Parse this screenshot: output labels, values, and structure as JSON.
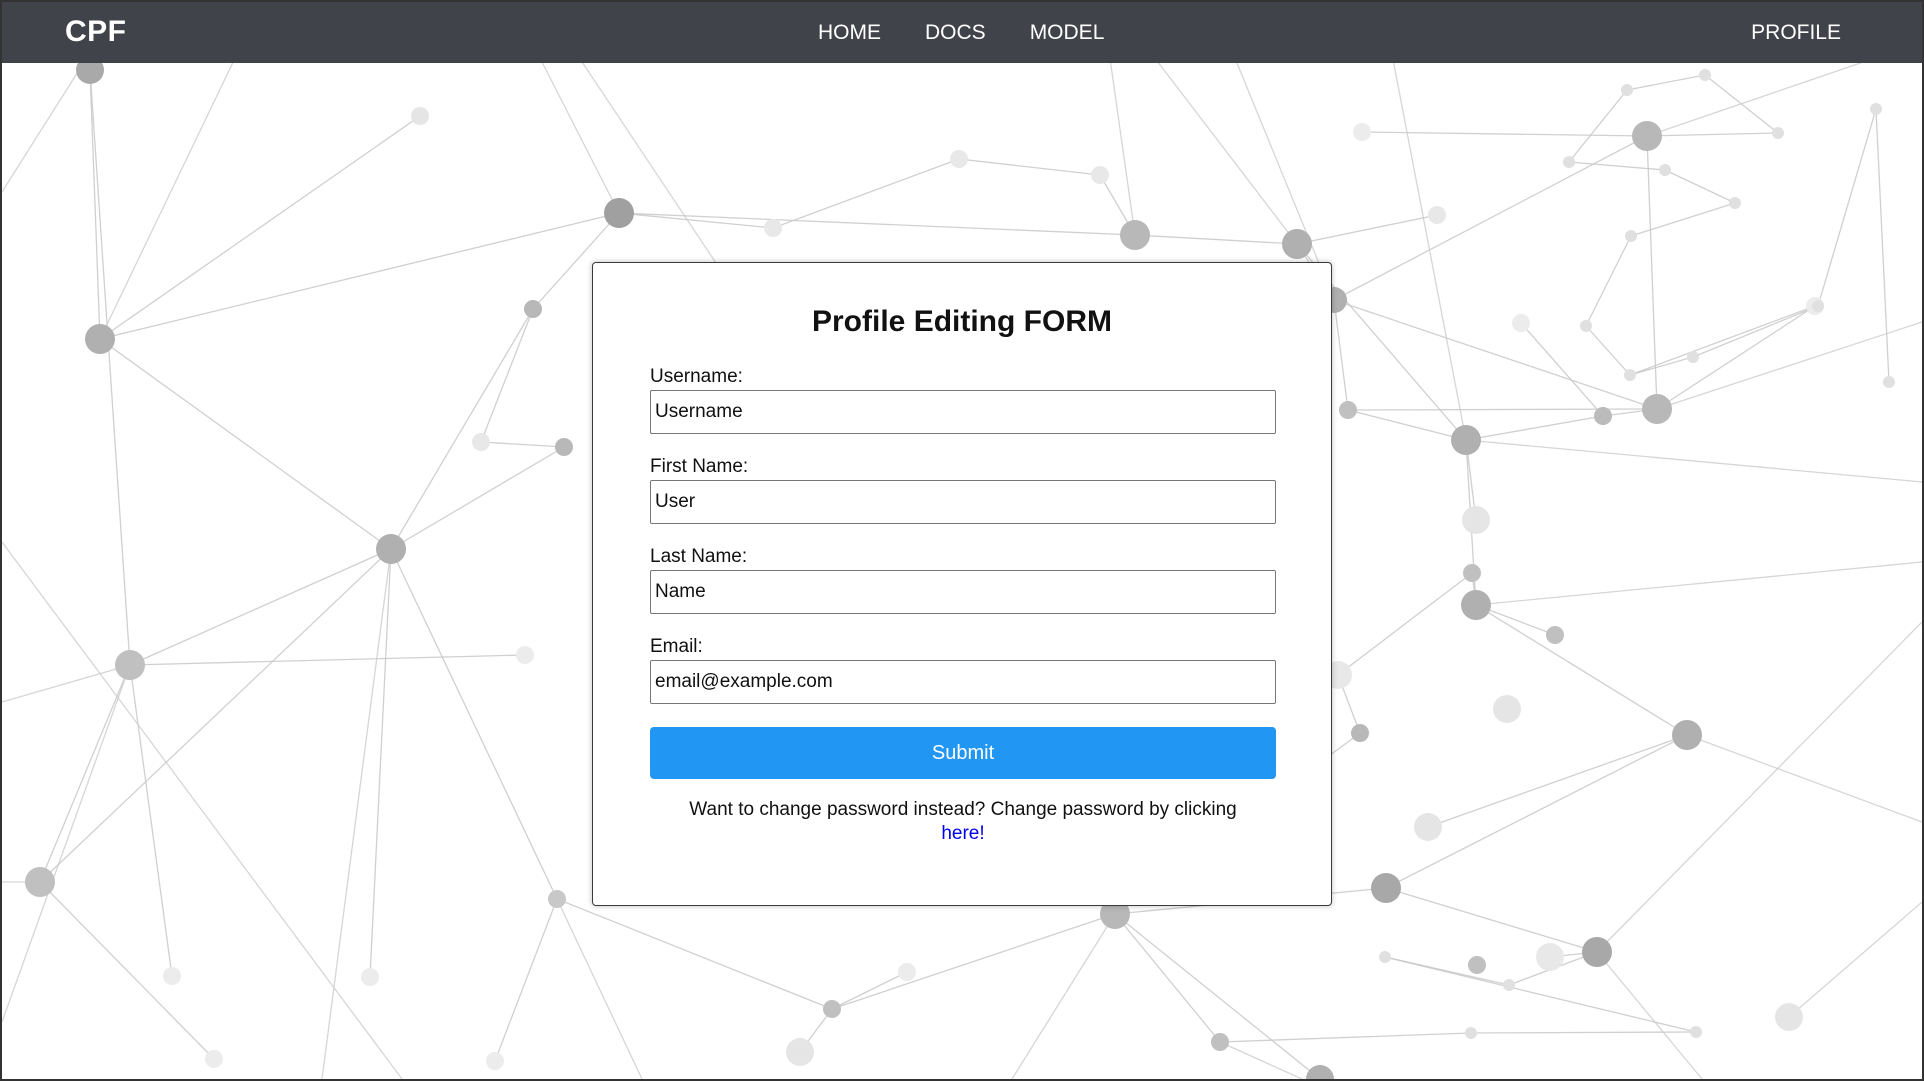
{
  "navbar": {
    "brand": "CPF",
    "links": [
      {
        "label": "HOME"
      },
      {
        "label": "DOCS"
      },
      {
        "label": "MODEL"
      }
    ],
    "profile": "PROFILE"
  },
  "form": {
    "title": "Profile Editing FORM",
    "fields": [
      {
        "label": "Username:",
        "value": "Username"
      },
      {
        "label": "First Name:",
        "value": "User"
      },
      {
        "label": "Last Name:",
        "value": "Name"
      },
      {
        "label": "Email:",
        "value": "email@example.com"
      }
    ],
    "submit_label": "Submit",
    "note_text": "Want to change password instead? Change password by clicking",
    "note_link": "here!"
  },
  "colors": {
    "navbar_bg": "#41434a",
    "submit_bg": "#2196f3",
    "link": "#0000ee"
  }
}
